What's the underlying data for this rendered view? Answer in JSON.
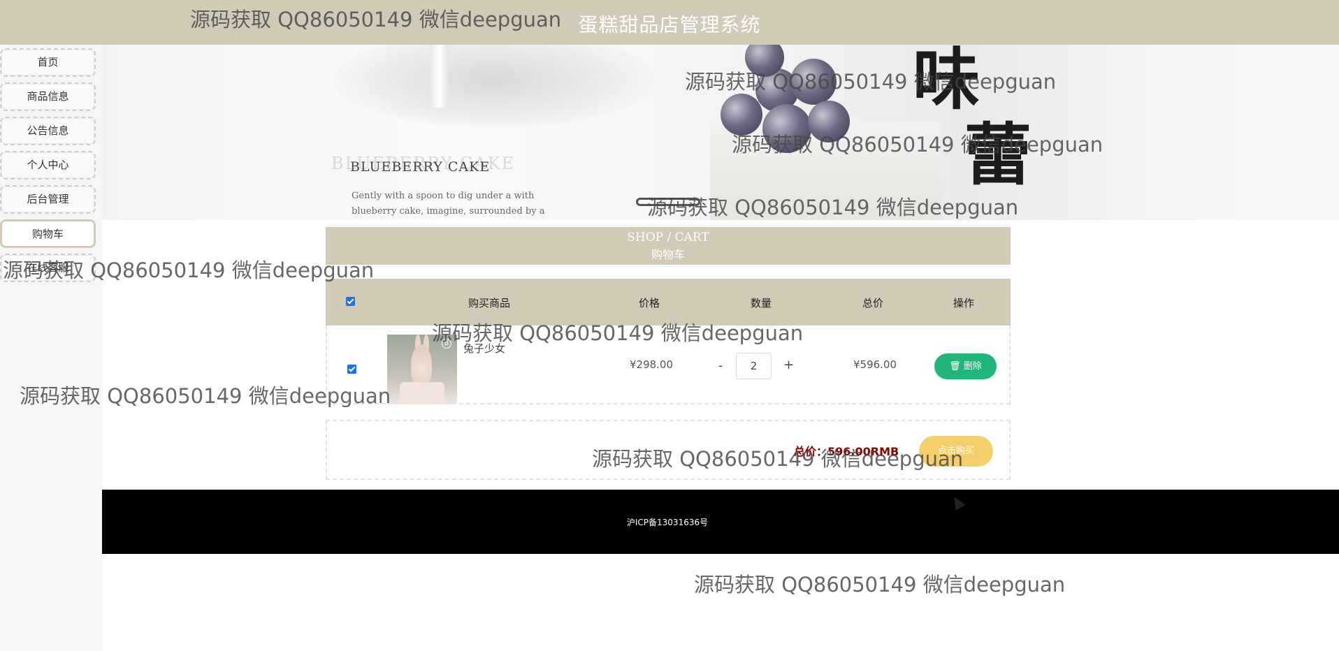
{
  "header": {
    "title": "蛋糕甜品店管理系统"
  },
  "sidebar": {
    "items": [
      {
        "label": "首页"
      },
      {
        "label": "商品信息"
      },
      {
        "label": "公告信息"
      },
      {
        "label": "个人中心"
      },
      {
        "label": "后台管理"
      },
      {
        "label": "购物车",
        "active": true
      },
      {
        "label": "在线客服"
      }
    ]
  },
  "banner": {
    "ghost_text": "BLUEBERRY CAKE",
    "cake_title": "BLUEBERRY  CAKE",
    "description": "Gently with a spoon to dig under a with blueberry cake, imagine, surrounded by a blueberry in the world.",
    "big_chars": [
      "味",
      "蕾"
    ]
  },
  "cart": {
    "heading_en": "SHOP / CART",
    "heading_cn": "购物车",
    "columns": [
      "购买商品",
      "价格",
      "数量",
      "总价",
      "操作"
    ],
    "items": [
      {
        "name": "兔子少女",
        "price": "¥298.00",
        "quantity": "2",
        "total": "¥596.00",
        "delete_label": "删除",
        "checked": true
      }
    ],
    "minus_label": "-",
    "plus_label": "+",
    "total_label": "总价：596.00RMB",
    "buy_label": "点击购买"
  },
  "footer": {
    "icp": "沪ICP备13031636号"
  },
  "watermark": "源码获取 QQ86050149 微信deepguan",
  "colors": {
    "accent": "#d1cab6",
    "delete": "#22b57a",
    "buy": "#f5cf6c",
    "total": "#8b0000"
  }
}
